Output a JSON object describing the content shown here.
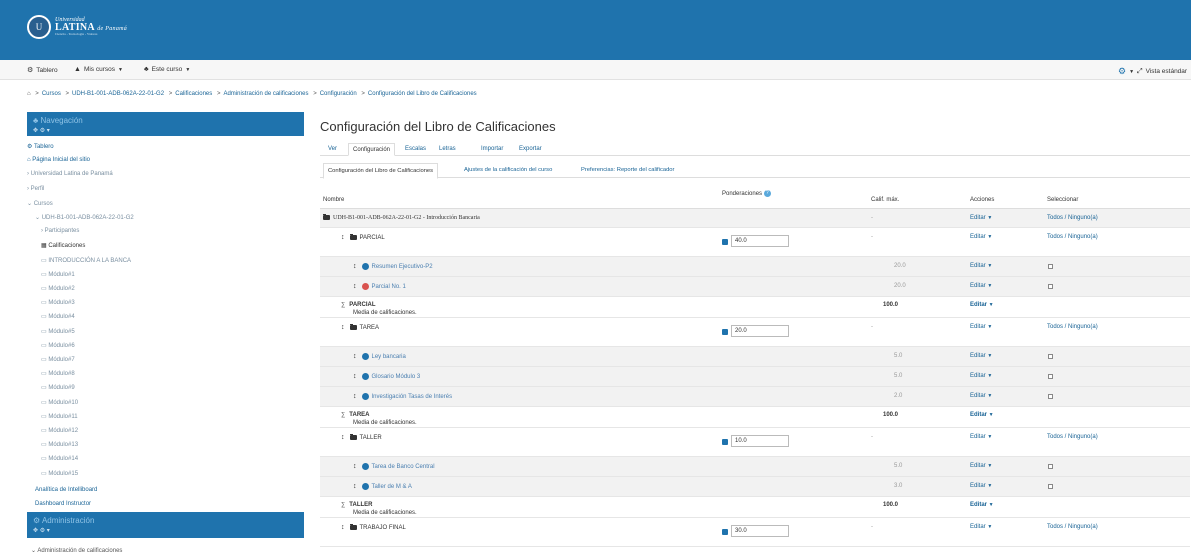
{
  "header": {
    "logo_line1": "Universidad",
    "logo_line2": "LATINA",
    "logo_line2b": "de Panamá",
    "logo_line3": "Ciencia - Tecnología - Valores"
  },
  "navbar": {
    "tablero": "Tablero",
    "mis_cursos": "Mis cursos",
    "este_curso": "Este curso",
    "vista": "Vista estándar"
  },
  "breadcrumb": [
    "Cursos",
    "UDH-B1-001-ADB-062A-22-01-G2",
    "Calificaciones",
    "Administración de calificaciones",
    "Configuración",
    "Configuración del Libro de Calificaciones"
  ],
  "sidebar": {
    "nav_title": "Navegación",
    "admin_title": "Administración",
    "items": [
      {
        "label": "Tablero",
        "kind": "top"
      },
      {
        "label": "Página Inicial del sitio",
        "kind": "top"
      },
      {
        "label": "Universidad Latina de Panamá",
        "kind": "top"
      },
      {
        "label": "Perfil",
        "kind": "top"
      },
      {
        "label": "Cursos",
        "kind": "top"
      },
      {
        "label": "UDH-B1-001-ADB-062A-22-01-G2",
        "kind": "course"
      },
      {
        "label": "Participantes",
        "kind": "sub"
      },
      {
        "label": "Calificaciones",
        "kind": "sub"
      },
      {
        "label": "INTRODUCCIÓN A LA BANCA",
        "kind": "mod"
      },
      {
        "label": "Módulo#1",
        "kind": "mod"
      },
      {
        "label": "Módulo#2",
        "kind": "mod"
      },
      {
        "label": "Módulo#3",
        "kind": "mod"
      },
      {
        "label": "Módulo#4",
        "kind": "mod"
      },
      {
        "label": "Módulo#5",
        "kind": "mod"
      },
      {
        "label": "Módulo#6",
        "kind": "mod"
      },
      {
        "label": "Módulo#7",
        "kind": "mod"
      },
      {
        "label": "Módulo#8",
        "kind": "mod"
      },
      {
        "label": "Módulo#9",
        "kind": "mod"
      },
      {
        "label": "Módulo#10",
        "kind": "mod"
      },
      {
        "label": "Módulo#11",
        "kind": "mod"
      },
      {
        "label": "Módulo#12",
        "kind": "mod"
      },
      {
        "label": "Módulo#13",
        "kind": "mod"
      },
      {
        "label": "Módulo#14",
        "kind": "mod"
      },
      {
        "label": "Módulo#15",
        "kind": "mod"
      },
      {
        "label": "Analítica de Intelliboard",
        "kind": "top"
      },
      {
        "label": "Dashboard Instructor",
        "kind": "top"
      }
    ],
    "admin_item": "Administración de calificaciones"
  },
  "page_title": "Configuración del Libro de Calificaciones",
  "tabs": [
    "Ver",
    "Configuración",
    "Escalas",
    "Letras",
    "Importar",
    "Exportar"
  ],
  "subtabs": [
    "Configuración del Libro de Calificaciones",
    "Ajustes de la calificación del curso",
    "Preferencias: Reporte del calificador"
  ],
  "table": {
    "headers": {
      "name": "Nombre",
      "weights": "Ponderaciones",
      "max": "Calif. máx.",
      "actions": "Acciones",
      "select": "Seleccionar"
    },
    "course_row": {
      "name": "UDH-B1-001-ADB-062A-22-01-G2 - Introducción Bancaria",
      "max": "-",
      "action": "Editar",
      "select": "Todos / Ninguno(a)"
    },
    "rows": [
      {
        "type": "category",
        "name": "PARCIAL",
        "weight": "40.0",
        "max": "-",
        "action": "Editar",
        "select": "Todos / Ninguno(a)"
      },
      {
        "type": "item",
        "name": "Resumen Ejecutivo-P2",
        "icon": "blue",
        "max": "20.0",
        "action": "Editar"
      },
      {
        "type": "item",
        "name": "Parcial No. 1",
        "icon": "red",
        "max": "20.0",
        "action": "Editar"
      },
      {
        "type": "total",
        "name": "PARCIAL",
        "desc": "Media de calificaciones.",
        "max": "100.0",
        "action": "Editar"
      },
      {
        "type": "category",
        "name": "TAREA",
        "weight": "20.0",
        "max": "-",
        "action": "Editar",
        "select": "Todos / Ninguno(a)"
      },
      {
        "type": "item",
        "name": "Ley bancaria",
        "icon": "blue",
        "max": "5.0",
        "action": "Editar"
      },
      {
        "type": "item",
        "name": "Glosario Módulo 3",
        "icon": "blue",
        "max": "5.0",
        "action": "Editar"
      },
      {
        "type": "item",
        "name": "Investigación Tasas de Interés",
        "icon": "blue",
        "max": "2.0",
        "action": "Editar"
      },
      {
        "type": "total",
        "name": "TAREA",
        "desc": "Media de calificaciones.",
        "max": "100.0",
        "action": "Editar"
      },
      {
        "type": "category",
        "name": "TALLER",
        "weight": "10.0",
        "max": "-",
        "action": "Editar",
        "select": "Todos / Ninguno(a)"
      },
      {
        "type": "item",
        "name": "Tarea de Banco Central",
        "icon": "blue",
        "max": "5.0",
        "action": "Editar"
      },
      {
        "type": "item",
        "name": "Taller de M & A",
        "icon": "blue",
        "max": "3.0",
        "action": "Editar"
      },
      {
        "type": "total",
        "name": "TALLER",
        "desc": "Media de calificaciones.",
        "max": "100.0",
        "action": "Editar"
      },
      {
        "type": "category",
        "name": "TRABAJO FINAL",
        "weight": "30.0",
        "max": "-",
        "action": "Editar",
        "select": "Todos / Ninguno(a)"
      }
    ]
  },
  "colors": {
    "brand": "#1f73ad",
    "link": "#1a6496"
  }
}
